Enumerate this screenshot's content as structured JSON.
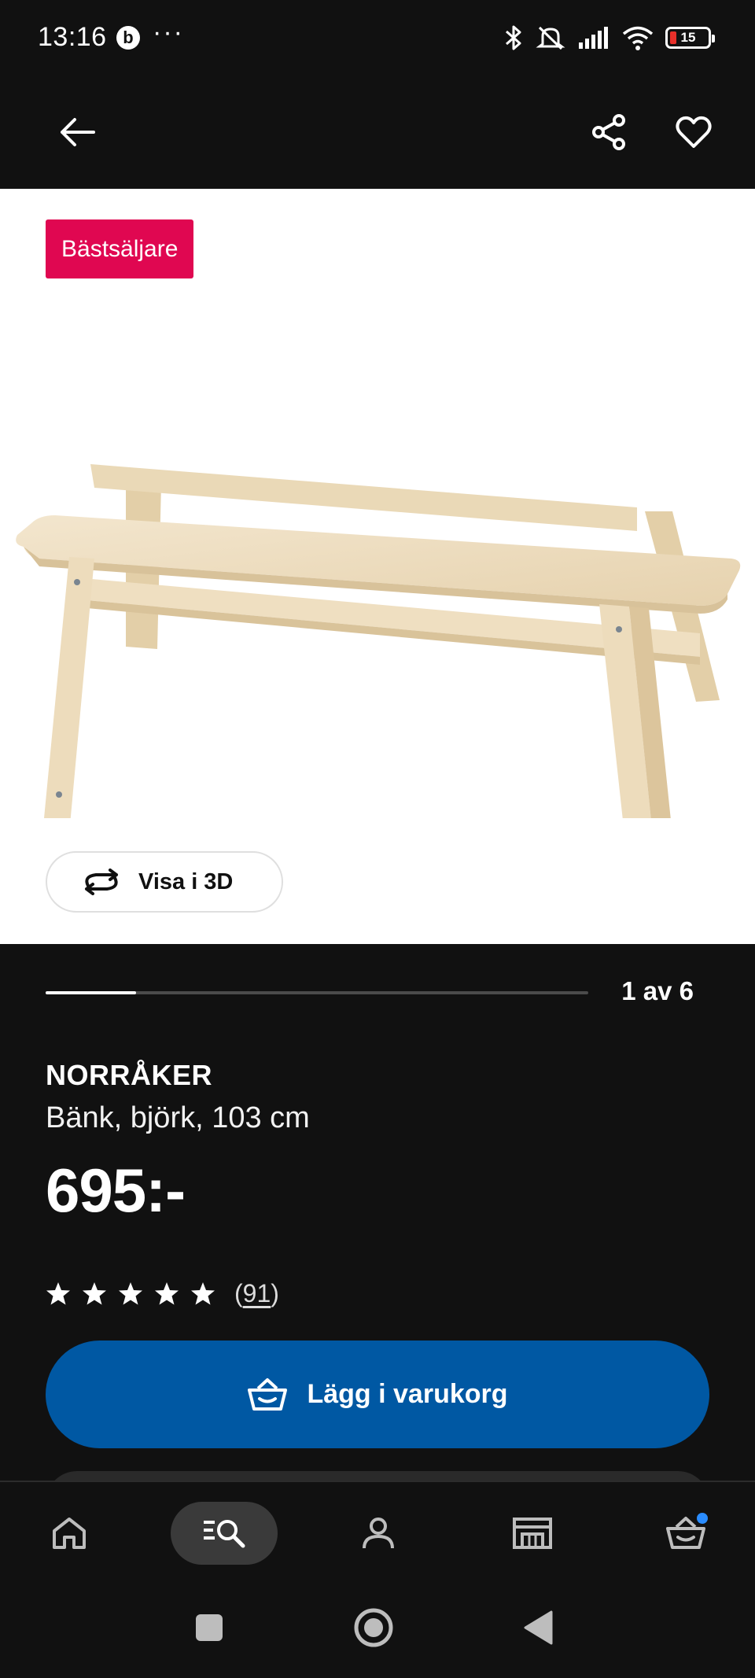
{
  "status_bar": {
    "time": "13:16",
    "app_badge": "b",
    "more": "···",
    "battery_level": "15"
  },
  "top_nav": {
    "back_icon": "arrow-left-icon",
    "share_icon": "share-icon",
    "favorite_icon": "heart-icon"
  },
  "media": {
    "badge": "Bästsäljare",
    "view_3d_label": "Visa i 3D",
    "page_indicator": "1 av 6",
    "current_page": 1,
    "total_pages": 6
  },
  "product": {
    "name": "NORRÅKER",
    "description": "Bänk, björk, 103 cm",
    "price": "695:-",
    "rating_stars": 5,
    "review_count": "91",
    "add_to_cart_label": "Lägg i varukorg"
  },
  "bottom_nav": {
    "items": [
      "home-icon",
      "search-list-icon",
      "profile-icon",
      "store-icon",
      "cart-icon"
    ],
    "active": "search-list-icon"
  },
  "system_nav": [
    "recents-icon",
    "home-circle-icon",
    "back-triangle-icon"
  ],
  "colors": {
    "background": "#111111",
    "badge": "#e00751",
    "primary_button": "#0058a3",
    "cart_notification": "#2a8cff"
  }
}
